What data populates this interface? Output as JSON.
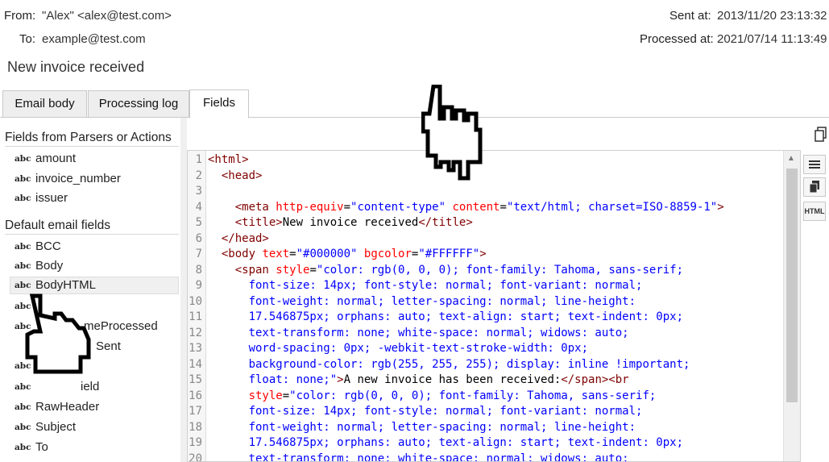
{
  "header": {
    "from_label": "From:",
    "from_value": "\"Alex\" <alex@test.com>",
    "to_label": "To:",
    "to_value": "example@test.com",
    "sent_label": "Sent at:",
    "sent_value": "2013/11/20 23:13:32",
    "processed_label": "Processed at:",
    "processed_value": "2021/07/14 11:13:49",
    "subject": "New invoice received"
  },
  "tabs": [
    {
      "label": "Email body",
      "active": false
    },
    {
      "label": "Processing log",
      "active": false
    },
    {
      "label": "Fields",
      "active": true
    }
  ],
  "fields_panel": {
    "group1_title": "Fields from Parsers or Actions",
    "group1_items": [
      "amount",
      "invoice_number",
      "issuer"
    ],
    "group2_title": "Default email fields",
    "group2_items": [
      "BCC",
      "Body",
      "BodyHTML",
      "",
      "meProcessed",
      "Sent",
      "",
      "ield",
      "RawHeader",
      "Subject",
      "To"
    ],
    "selected": "BodyHTML",
    "type_badge": "abc"
  },
  "code": {
    "line_numbers": [
      "1",
      "2",
      "3",
      "4",
      "5",
      "6",
      "7",
      "8",
      "9",
      "10",
      "11",
      "12",
      "13",
      "14",
      "15",
      "16",
      "17",
      "18",
      "19",
      "20"
    ]
  },
  "toolbar": {
    "html_label": "HTML"
  },
  "icons": {
    "copy": "copy-icon",
    "menu": "hamburger-menu-icon",
    "copy_all": "copy-all-icon",
    "cursor": "hand-pointer-icon"
  },
  "colors": {
    "tag": "#800000",
    "attribute": "#ff0000",
    "value": "#0000ff"
  }
}
